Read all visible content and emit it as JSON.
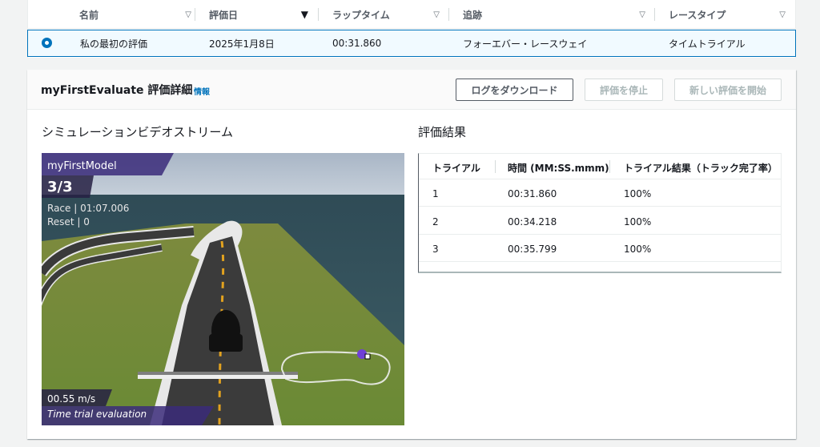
{
  "list": {
    "columns": [
      {
        "label": "名前",
        "sort": "none"
      },
      {
        "label": "評価日",
        "sort": "desc"
      },
      {
        "label": "ラップタイム",
        "sort": "none"
      },
      {
        "label": "追跡",
        "sort": "none"
      },
      {
        "label": "レースタイプ",
        "sort": "none"
      }
    ],
    "row": {
      "selected": true,
      "name": "私の最初の評価",
      "date": "2025年1月8日",
      "lap_time": "00:31.860",
      "track": "フォーエバー・レースウェイ",
      "race_type": "タイムトライアル"
    }
  },
  "detail": {
    "title": "myFirstEvaluate 評価詳細",
    "info_label": "情報",
    "buttons": {
      "download_logs": "ログをダウンロード",
      "stop_evaluation": "評価を停止",
      "start_new": "新しい評価を開始"
    },
    "video_section_title": "シミュレーションビデオストリーム",
    "results_section_title": "評価結果"
  },
  "video": {
    "model_name": "myFirstModel",
    "lap_counter": "3/3",
    "race_time": "Race | 01:07.006",
    "reset_count": "Reset | 0",
    "speed": "00.55 m/s",
    "mode_label": "Time trial evaluation"
  },
  "results": {
    "headers": [
      "トライアル",
      "時間 (MM:SS.mmm)",
      "トライアル結果（トラック完了率）"
    ],
    "rows": [
      {
        "trial": "1",
        "time": "00:31.860",
        "completion": "100%"
      },
      {
        "trial": "2",
        "time": "00:34.218",
        "completion": "100%"
      },
      {
        "trial": "3",
        "time": "00:35.799",
        "completion": "100%"
      }
    ]
  },
  "colors": {
    "link": "#0073bb",
    "selected_row_bg": "#f1faff",
    "overlay_purple": "#5a3fb5"
  },
  "icons": [
    "sort-triangle-icon",
    "sort-descending-icon",
    "radio-selected-icon"
  ]
}
